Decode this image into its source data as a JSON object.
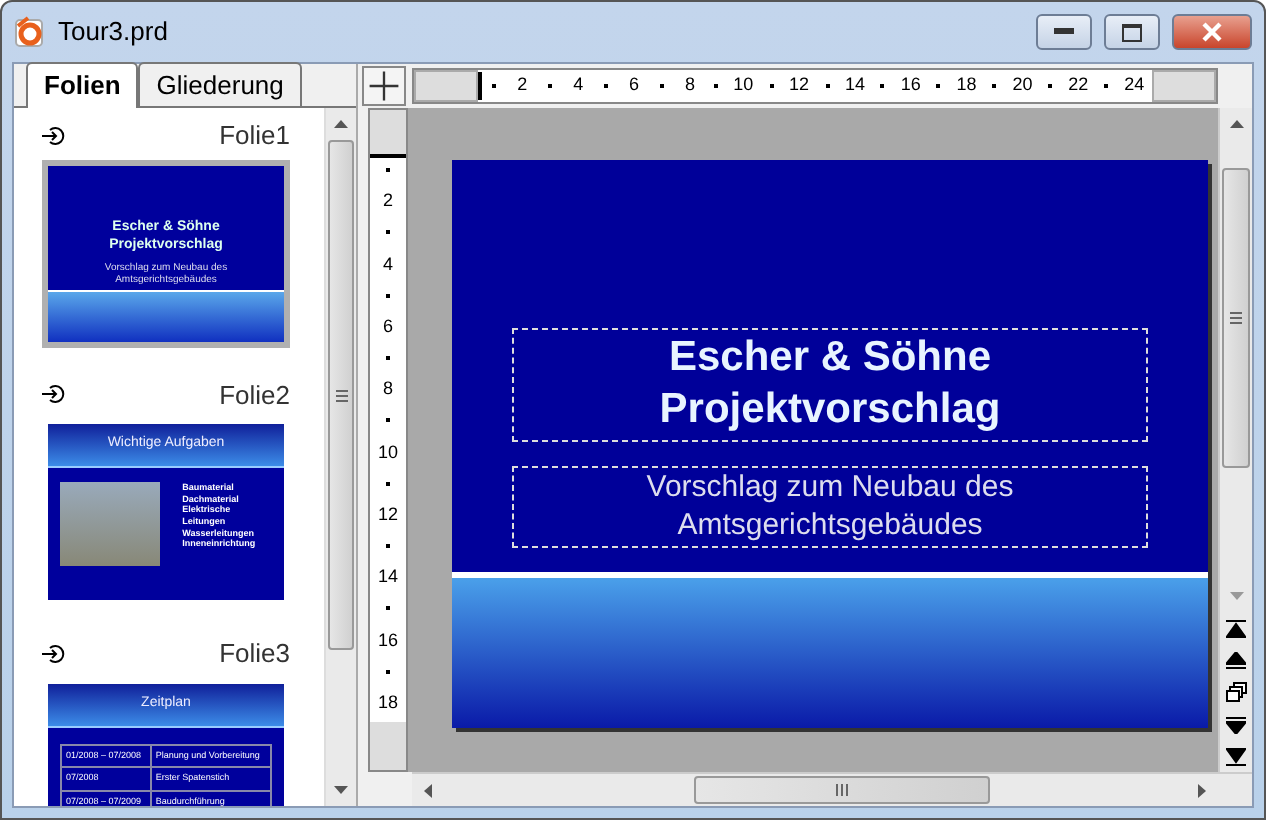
{
  "window": {
    "title": "Tour3.prd"
  },
  "tabs": [
    {
      "label": "Folien",
      "selected": true
    },
    {
      "label": "Gliederung",
      "selected": false
    }
  ],
  "slides": [
    {
      "label": "Folie1",
      "selected": true,
      "kind": "title",
      "title": "Escher & Söhne Projektvorschlag",
      "subtitle": "Vorschlag zum Neubau des Amtsgerichtsgebäudes"
    },
    {
      "label": "Folie2",
      "selected": false,
      "kind": "bullets",
      "title": "Wichtige Aufgaben",
      "bullets": [
        "Baumaterial",
        "Dachmaterial",
        "Elektrische Leitungen",
        "Wasserleitungen",
        "Inneneinrichtung"
      ]
    },
    {
      "label": "Folie3",
      "selected": false,
      "kind": "table",
      "title": "Zeitplan",
      "rows": [
        [
          "01/2008 – 07/2008",
          "Planung und Vorbereitung"
        ],
        [
          "07/2008",
          "Erster Spatenstich"
        ],
        [
          "07/2008 – 07/2009",
          "Baudurchführung"
        ]
      ]
    }
  ],
  "ruler_h": [
    "2",
    "4",
    "6",
    "8",
    "10",
    "12",
    "14",
    "16",
    "18",
    "20",
    "22",
    "24"
  ],
  "ruler_v": [
    "2",
    "4",
    "6",
    "8",
    "10",
    "12",
    "14",
    "16",
    "18"
  ],
  "slide": {
    "title": "Escher & Söhne Projektvorschlag",
    "subtitle": "Vorschlag zum Neubau des Amtsgerichtsgebäudes"
  }
}
